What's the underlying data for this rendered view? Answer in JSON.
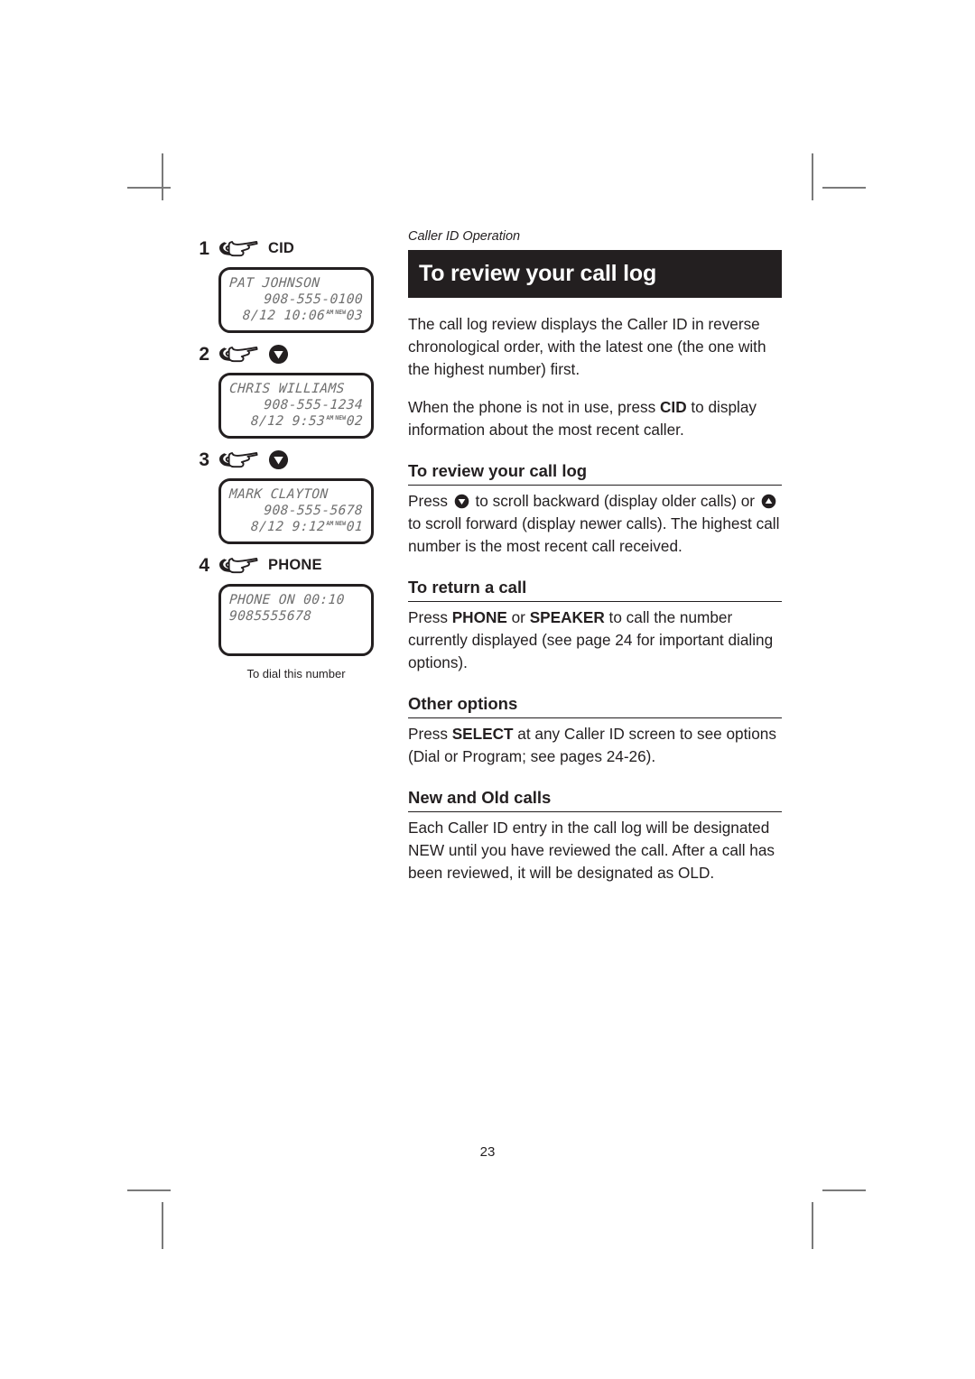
{
  "running_head": "Caller ID Operation",
  "title": "To review your call log",
  "folio": "23",
  "steps": [
    {
      "num": "1",
      "icon": "pointing-hand-icon",
      "label": "CID",
      "label_type": "text"
    },
    {
      "num": "2",
      "icon": "pointing-hand-icon",
      "label": "",
      "label_type": "arrow-down"
    },
    {
      "num": "3",
      "icon": "pointing-hand-icon",
      "label": "",
      "label_type": "arrow-down"
    },
    {
      "num": "4",
      "icon": "pointing-hand-icon",
      "label": "PHONE",
      "label_type": "text"
    }
  ],
  "screens": [
    {
      "name": "PAT JOHNSON",
      "number": "908-555-0100",
      "date": "8/12",
      "time": "10:06",
      "meridiem": "AM",
      "status": "NEW",
      "call_number": "03"
    },
    {
      "name": "CHRIS WILLIAMS",
      "number": "908-555-1234",
      "date": "8/12",
      "time": "9:53",
      "meridiem": "AM",
      "status": "NEW",
      "call_number": "02"
    },
    {
      "name": "MARK CLAYTON",
      "number": "908-555-5678",
      "date": "8/12",
      "time": "9:12",
      "meridiem": "AM",
      "status": "NEW",
      "call_number": "01"
    }
  ],
  "phone_screen": {
    "line1": "PHONE ON  00:10",
    "line2": "9085555678"
  },
  "caption": "To dial this number",
  "intro": {
    "p1": "The call log review displays the Caller ID in reverse chronological order, with the latest one (the one with the highest number) first.",
    "p2_a": "When the phone is not in use, press ",
    "p2_b": "CID",
    "p2_c": " to display information about the most recent caller."
  },
  "sections": [
    {
      "heading": "To review your call log",
      "p_a": "Press ",
      "p_b": " to scroll backward (display older calls) or ",
      "p_c": " to scroll forward (display newer calls). The highest call number is the most recent call received."
    },
    {
      "heading": "To return a call",
      "p_a": "Press ",
      "p_b": "PHONE",
      "p_c": " or ",
      "p_d": "SPEAKER",
      "p_e": " to call the number currently displayed (see page 24 for important dialing options)."
    },
    {
      "heading": "Other options",
      "p_a": "Press ",
      "p_b": "SELECT",
      "p_c": " at any Caller ID screen to see options (Dial or Program; see pages 24-26)."
    },
    {
      "heading": "New and Old calls",
      "p_a": "Each Caller ID entry in the call log will be designated NEW until you have reviewed the call. After a call has been reviewed, it will be designated as OLD."
    }
  ],
  "colors": {
    "ink": "#231f20",
    "lcd_text": "#6f6f6f",
    "crop_mark": "#7a7a7a"
  }
}
